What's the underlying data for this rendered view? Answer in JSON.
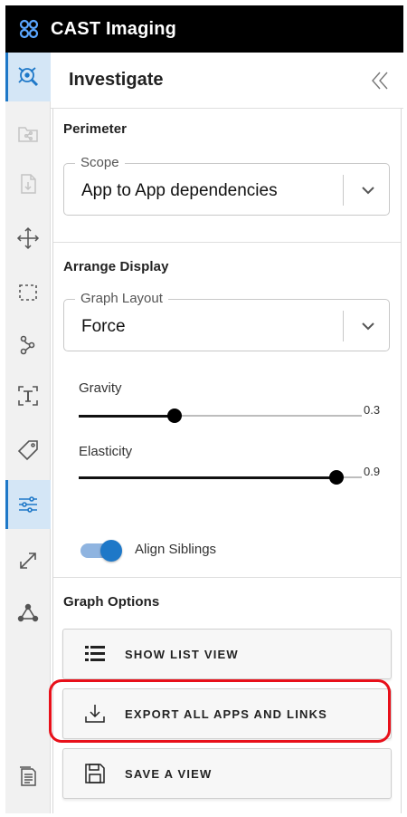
{
  "app": {
    "title": "CAST Imaging",
    "logo_icon": "cast-logo-icon",
    "accent": "#1e78c8"
  },
  "sidebar": {
    "items": [
      {
        "id": "investigate",
        "icon": "investigate-icon",
        "active": true
      },
      {
        "id": "folder-share",
        "icon": "folder-share-icon",
        "active": false
      },
      {
        "id": "document-download",
        "icon": "document-download-icon",
        "active": false
      },
      {
        "id": "move",
        "icon": "move-arrows-icon",
        "active": false
      },
      {
        "id": "select",
        "icon": "dashed-select-icon",
        "active": false
      },
      {
        "id": "path",
        "icon": "path-nodes-icon",
        "active": false
      },
      {
        "id": "text",
        "icon": "text-box-icon",
        "active": false
      },
      {
        "id": "tag",
        "icon": "tag-icon",
        "active": false
      },
      {
        "id": "settings",
        "icon": "sliders-icon",
        "active": true
      },
      {
        "id": "expand",
        "icon": "expand-icon",
        "active": false
      },
      {
        "id": "graph",
        "icon": "graph-nodes-icon",
        "active": false
      },
      {
        "id": "report",
        "icon": "report-icon",
        "active": false
      }
    ]
  },
  "panel": {
    "title": "Investigate",
    "collapse_icon": "double-chevron-left-icon",
    "perimeter": {
      "title": "Perimeter",
      "scope": {
        "label": "Scope",
        "value": "App to App dependencies"
      }
    },
    "arrange": {
      "title": "Arrange Display",
      "layout": {
        "label": "Graph Layout",
        "value": "Force"
      },
      "gravity": {
        "label": "Gravity",
        "value": "0.3",
        "level": 0.34
      },
      "elasticity": {
        "label": "Elasticity",
        "value": "0.9",
        "level": 0.91
      },
      "align_siblings": {
        "label": "Align Siblings",
        "on": true
      }
    },
    "graph_options": {
      "title": "Graph Options",
      "buttons": [
        {
          "label": "SHOW LIST VIEW",
          "icon": "list-icon"
        },
        {
          "label": "EXPORT ALL APPS AND LINKS",
          "icon": "download-icon"
        },
        {
          "label": "SAVE A VIEW",
          "icon": "save-icon"
        }
      ]
    }
  },
  "annotation": {
    "color": "#e8101a"
  }
}
